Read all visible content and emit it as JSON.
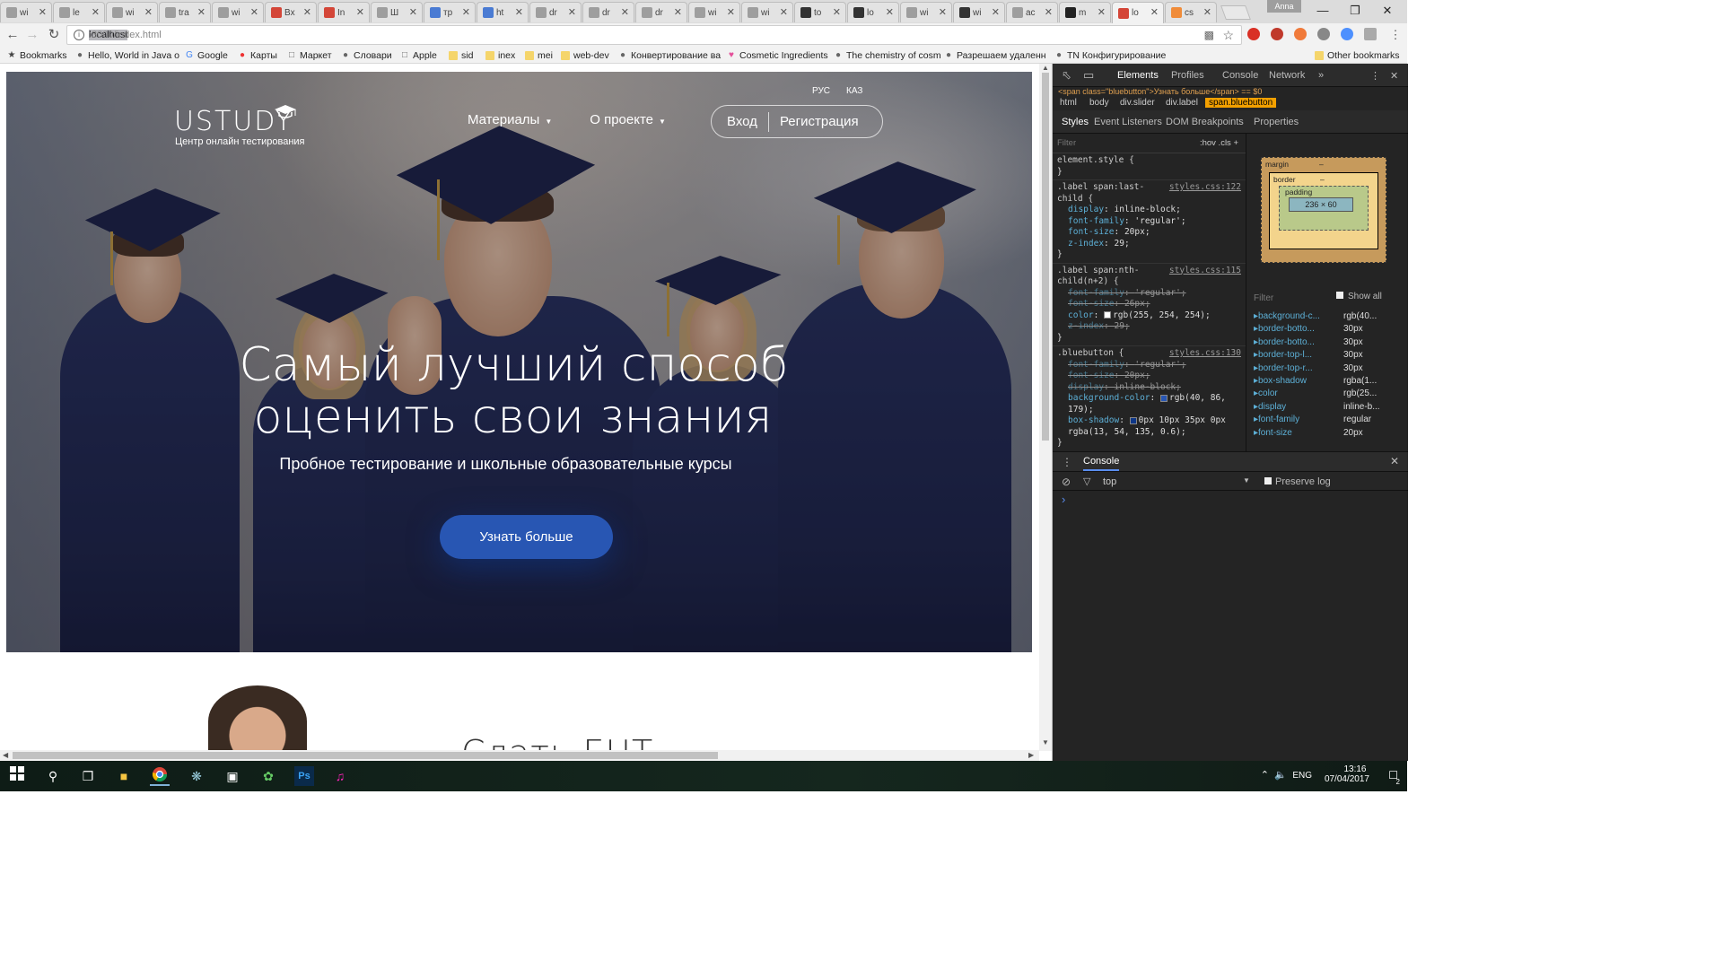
{
  "browser": {
    "tabs": [
      {
        "title": "wi",
        "color": "#9e9e9e"
      },
      {
        "title": "le",
        "color": "#9e9e9e"
      },
      {
        "title": "wi",
        "color": "#9e9e9e"
      },
      {
        "title": "tra",
        "color": "#9e9e9e"
      },
      {
        "title": "wi",
        "color": "#9e9e9e"
      },
      {
        "title": "Bx",
        "color": "#d44638"
      },
      {
        "title": "In",
        "color": "#d44638"
      },
      {
        "title": "Ш",
        "color": "#9e9e9e"
      },
      {
        "title": "тр",
        "color": "#4a7bd3"
      },
      {
        "title": "ht",
        "color": "#4a7bd3"
      },
      {
        "title": "dr",
        "color": "#9e9e9e"
      },
      {
        "title": "dr",
        "color": "#9e9e9e"
      },
      {
        "title": "dr",
        "color": "#9e9e9e"
      },
      {
        "title": "wi",
        "color": "#9e9e9e"
      },
      {
        "title": "wi",
        "color": "#9e9e9e"
      },
      {
        "title": "to",
        "color": "#333333"
      },
      {
        "title": "lo",
        "color": "#333333"
      },
      {
        "title": "wi",
        "color": "#9e9e9e"
      },
      {
        "title": "wi",
        "color": "#333333"
      },
      {
        "title": "ac",
        "color": "#9e9e9e"
      },
      {
        "title": "m",
        "color": "#222222"
      },
      {
        "title": "lo",
        "color": "#d44638"
      },
      {
        "title": "cs",
        "color": "#f08c3a"
      }
    ],
    "profile": "Anna",
    "url_host": "localhost",
    "url_rest": ":3000/index.html",
    "bookmarks": [
      {
        "label": "Bookmarks",
        "icon": "star-icon"
      },
      {
        "label": "Hello, World in Java o",
        "icon": "site-icon"
      },
      {
        "label": "Google",
        "icon": "google-icon"
      },
      {
        "label": "Карты",
        "icon": "map-pin-icon"
      },
      {
        "label": "Маркет",
        "icon": "page-icon"
      },
      {
        "label": "Словари",
        "icon": "site-icon"
      },
      {
        "label": "Apple",
        "icon": "page-icon"
      },
      {
        "label": "sid",
        "icon": "folder-icon"
      },
      {
        "label": "inex",
        "icon": "folder-icon"
      },
      {
        "label": "mei",
        "icon": "folder-icon"
      },
      {
        "label": "web-dev",
        "icon": "folder-icon"
      },
      {
        "label": "Конвертирование ва",
        "icon": "site-icon"
      },
      {
        "label": "Cosmetic Ingredients",
        "icon": "heart-icon"
      },
      {
        "label": "The chemistry of cosm",
        "icon": "site-icon"
      },
      {
        "label": "Разрешаем удаленн",
        "icon": "site-icon"
      },
      {
        "label": "TN  Конфигурирование",
        "icon": "site-icon"
      }
    ],
    "other_bookmarks": "Other bookmarks"
  },
  "site": {
    "logo": "USTUDY",
    "logo_sub": "Центр онлайн тестирования",
    "lang": [
      "РУС",
      "КАЗ"
    ],
    "menu": [
      "Материалы",
      "О проекте"
    ],
    "login": "Вход",
    "register": "Регистрация",
    "headline_1": "Самый лучший способ",
    "headline_2": "оценить свои знания",
    "subline": "Пробное тестирование и школьные образовательные курсы",
    "cta": "Узнать больше",
    "below_title": "Слать ЕНТ"
  },
  "devtools": {
    "tabs": [
      "Elements",
      "Profiles",
      "Console",
      "Network"
    ],
    "selected_html": "<span class=\"bluebutton\">Узнать больше</span> == $0",
    "crumbs": [
      "html",
      "body",
      "div.slider",
      "div.label",
      "span.bluebutton"
    ],
    "subtabs": [
      "Styles",
      "Event Listeners",
      "DOM Breakpoints",
      "Properties"
    ],
    "filter": "Filter",
    "hov": ":hov  .cls  +",
    "rules": [
      {
        "selector": "element.style {",
        "source": "",
        "props": []
      },
      {
        "selector": ".label span:last-child {",
        "source": "styles.css:122",
        "props": [
          {
            "n": "display",
            "v": "inline-block;",
            "s": false
          },
          {
            "n": "font-family",
            "v": "'regular';",
            "s": false
          },
          {
            "n": "font-size",
            "v": "20px;",
            "s": false
          },
          {
            "n": "z-index",
            "v": "29;",
            "s": false
          }
        ]
      },
      {
        "selector": ".label span:nth-child(n+2) {",
        "source": "styles.css:115",
        "props": [
          {
            "n": "font-family",
            "v": "'regular';",
            "s": true
          },
          {
            "n": "font-size",
            "v": "26px;",
            "s": true
          },
          {
            "n": "color",
            "v": "rgb(255, 254, 254);",
            "s": false
          },
          {
            "n": "z-index",
            "v": "29;",
            "s": true
          }
        ]
      },
      {
        "selector": ".bluebutton {",
        "source": "styles.css:130",
        "props": [
          {
            "n": "font-family",
            "v": "'regular';",
            "s": true
          },
          {
            "n": "font-size",
            "v": "20px;",
            "s": true
          },
          {
            "n": "display",
            "v": "inline-block;",
            "s": true
          },
          {
            "n": "background-color",
            "v": "rgb(40, 86, 179);",
            "s": false
          },
          {
            "n": "box-shadow",
            "v": "0px 10px 35px 0px rgba(13, 54, 135, 0.6);",
            "s": false
          }
        ]
      }
    ],
    "box_model": {
      "margin": "margin",
      "border": "border",
      "padding": "padding",
      "dash": "–",
      "content": "236 × 60"
    },
    "computed_filter": "Filter",
    "show_all": "Show all",
    "computed": [
      {
        "n": "background-c...",
        "v": "rgb(40..."
      },
      {
        "n": "border-botto...",
        "v": "30px"
      },
      {
        "n": "border-botto...",
        "v": "30px"
      },
      {
        "n": "border-top-l...",
        "v": "30px"
      },
      {
        "n": "border-top-r...",
        "v": "30px"
      },
      {
        "n": "box-shadow",
        "v": "rgba(1..."
      },
      {
        "n": "color",
        "v": "rgb(25..."
      },
      {
        "n": "display",
        "v": "inline-b..."
      },
      {
        "n": "font-family",
        "v": "regular"
      },
      {
        "n": "font-size",
        "v": "20px"
      }
    ],
    "console_title": "Console",
    "console_context": "top",
    "preserve_log": "Preserve log",
    "prompt": "›"
  },
  "taskbar": {
    "lang": "ENG",
    "time": "13:16",
    "date": "07/04/2017",
    "notifications": "2"
  },
  "colors": {
    "accent": "#2856b3",
    "devtools_bg": "#242424"
  }
}
